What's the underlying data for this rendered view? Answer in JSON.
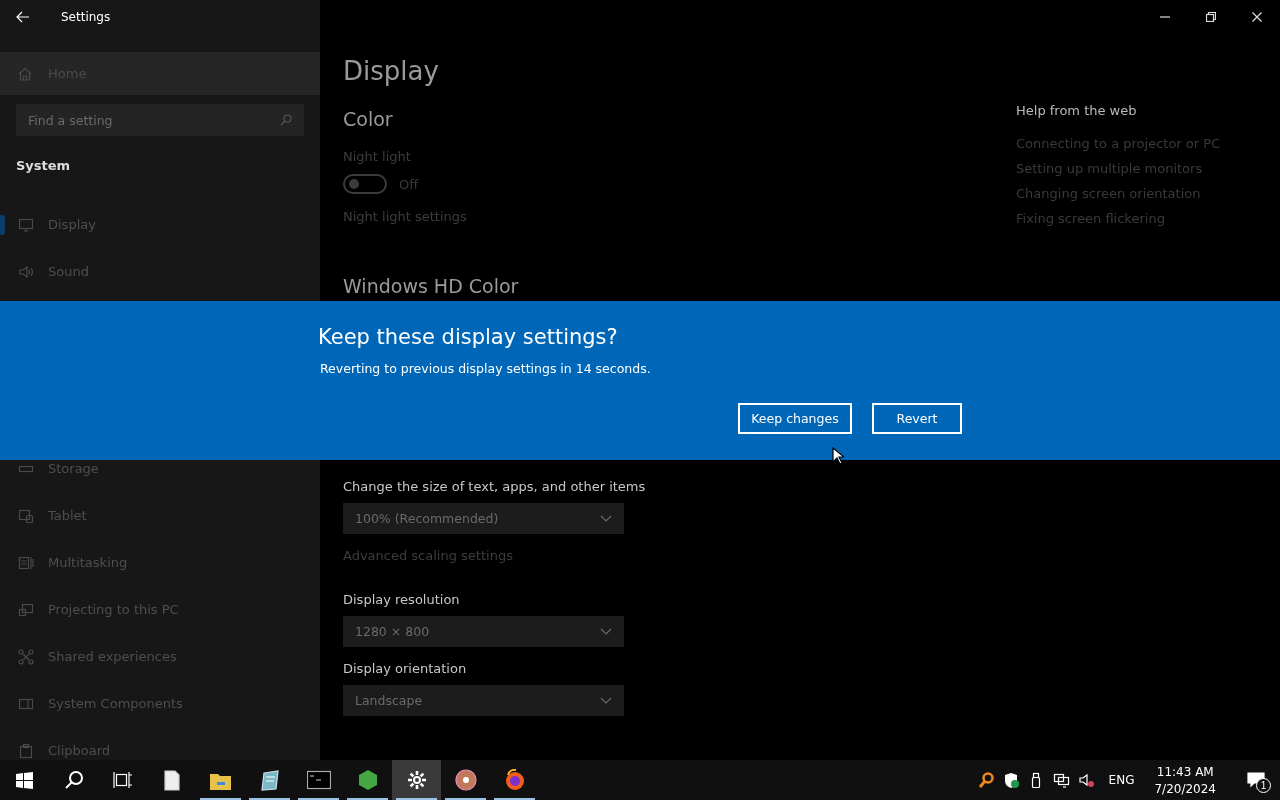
{
  "window": {
    "title": "Settings"
  },
  "sidebar": {
    "home": "Home",
    "search": {
      "placeholder": "Find a setting"
    },
    "section": "System",
    "items": [
      {
        "label": "Display",
        "kind": "display",
        "selected": true
      },
      {
        "label": "Sound",
        "kind": "sound",
        "selected": false
      },
      {
        "label": "Storage",
        "kind": "storage",
        "selected": false
      },
      {
        "label": "Tablet",
        "kind": "tablet",
        "selected": false
      },
      {
        "label": "Multitasking",
        "kind": "multitasking",
        "selected": false
      },
      {
        "label": "Projecting to this PC",
        "kind": "projecting",
        "selected": false
      },
      {
        "label": "Shared experiences",
        "kind": "shared",
        "selected": false
      },
      {
        "label": "System Components",
        "kind": "components",
        "selected": false
      },
      {
        "label": "Clipboard",
        "kind": "clipboard",
        "selected": false
      }
    ]
  },
  "page": {
    "title": "Display",
    "color_heading": "Color",
    "night_light": {
      "label": "Night light",
      "on": false,
      "state_text": "Off"
    },
    "night_light_link": "Night light settings",
    "hd_heading": "Windows HD Color",
    "scale": {
      "label": "Change the size of text, apps, and other items",
      "value": "100% (Recommended)"
    },
    "advanced_link": "Advanced scaling settings",
    "resolution": {
      "label": "Display resolution",
      "value": "1280 × 800"
    },
    "orientation": {
      "label": "Display orientation",
      "value": "Landscape"
    }
  },
  "help": {
    "heading": "Help from the web",
    "links": [
      "Connecting to a projector or PC",
      "Setting up multiple monitors",
      "Changing screen orientation",
      "Fixing screen flickering"
    ]
  },
  "dialog": {
    "title": "Keep these display settings?",
    "message": "Reverting to previous display settings in 14 seconds.",
    "buttons": [
      "Keep changes",
      "Revert"
    ]
  },
  "taskbar": {
    "apps": [
      {
        "kind": "start",
        "running": false,
        "selected": false
      },
      {
        "kind": "search",
        "running": false,
        "selected": false
      },
      {
        "kind": "taskview",
        "running": false,
        "selected": false
      },
      {
        "kind": "document",
        "running": false,
        "selected": false
      },
      {
        "kind": "folder",
        "running": true,
        "selected": false
      },
      {
        "kind": "notepad",
        "running": true,
        "selected": false
      },
      {
        "kind": "terminal",
        "running": true,
        "selected": false
      },
      {
        "kind": "cube",
        "running": true,
        "selected": false
      },
      {
        "kind": "gear",
        "running": true,
        "selected": true
      },
      {
        "kind": "disc",
        "running": true,
        "selected": false
      },
      {
        "kind": "browser",
        "running": true,
        "selected": false
      }
    ],
    "language": "ENG",
    "time": "11:43 AM",
    "date": "7/20/2024",
    "notifications": "1"
  }
}
